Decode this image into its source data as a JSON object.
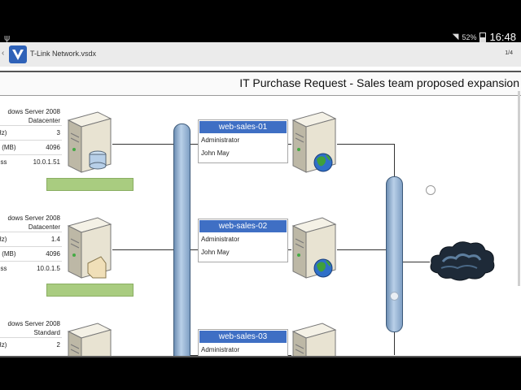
{
  "status_bar": {
    "battery_percent": "52%",
    "time": "16:48"
  },
  "action_bar": {
    "up_glyph": "‹",
    "title": "T-Link Network.vsdx",
    "page_indicator": "1/4"
  },
  "diagram": {
    "title": "IT Purchase Request - Sales team proposed expansion",
    "servers": [
      {
        "os_line1": "dows Server 2008",
        "os_line2": "Datacenter",
        "rows": [
          {
            "label": "Hz)",
            "value": "3"
          },
          {
            "label": "y (MB)",
            "value": "4096"
          },
          {
            "label": "ess",
            "value": "10.0.1.51"
          }
        ]
      },
      {
        "os_line1": "dows Server 2008",
        "os_line2": "Datacenter",
        "rows": [
          {
            "label": "Hz)",
            "value": "1.4"
          },
          {
            "label": "y (MB)",
            "value": "4096"
          },
          {
            "label": "ess",
            "value": "10.0.1.5"
          }
        ]
      },
      {
        "os_line1": "dows Server 2008",
        "os_line2": "Standard",
        "rows": [
          {
            "label": "Hz)",
            "value": "2"
          }
        ]
      }
    ],
    "web_servers": [
      {
        "name": "web-sales-01",
        "role": "Administrator",
        "owner": "John May"
      },
      {
        "name": "web-sales-02",
        "role": "Administrator",
        "owner": "John May"
      },
      {
        "name": "web-sales-03",
        "role": "Administrator",
        "owner": ""
      }
    ],
    "colors": {
      "header_blue": "#3f6fc4",
      "status_green": "#a9cc80",
      "pipe_blue": "#7f9fc4"
    }
  }
}
